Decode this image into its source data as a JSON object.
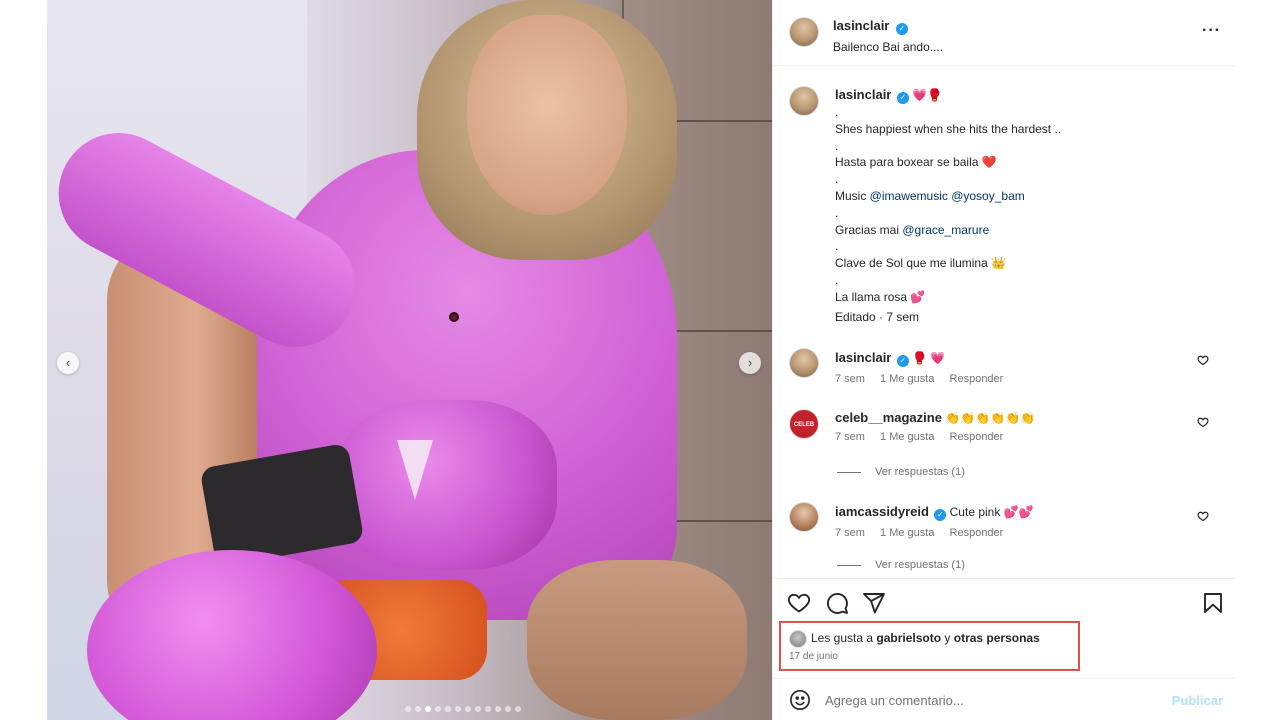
{
  "media": {
    "prev_glyph": "‹",
    "next_glyph": "›",
    "dot_count": 12,
    "active_dot": 2
  },
  "header": {
    "username": "lasinclair",
    "verified_glyph": "✓",
    "subtitle": "Bailenco Bai ando....",
    "more_glyph": "···"
  },
  "caption": {
    "username": "lasinclair",
    "verified_glyph": "✓",
    "emojis": "💗🥊",
    "lines": [
      ".",
      "Shes happiest when she hits the hardest ..",
      ".",
      "Hasta para boxear se baila ❤️",
      ".",
      "Music ",
      ".",
      "Gracias mai ",
      ".",
      "Clave de Sol que me ilumina 👑",
      ".",
      "La llama rosa 💕"
    ],
    "music_links": "@imawemusic @yosoy_bam",
    "thanks_link": "@grace_marure",
    "edited": "Editado · 7 sem"
  },
  "comments": [
    {
      "username": "lasinclair",
      "verified_glyph": "✓",
      "text": "🥊 💗",
      "time": "7 sem",
      "likes": "1 Me gusta",
      "reply": "Responder"
    },
    {
      "username": "celeb__magazine",
      "text": "👏👏👏👏👏👏",
      "time": "7 sem",
      "likes": "1 Me gusta",
      "reply": "Responder",
      "avatar_text": "CELEB MAGAZINE",
      "replies": "Ver respuestas (1)"
    },
    {
      "username": "iamcassidyreid",
      "verified_glyph": "✓",
      "text": "Cute pink 💕💕",
      "time": "7 sem",
      "likes": "1 Me gusta",
      "reply": "Responder",
      "replies": "Ver respuestas (1)"
    }
  ],
  "likes": {
    "prefix": "Les gusta a ",
    "user": "gabrielsoto",
    "middle": " y ",
    "others": "otras personas",
    "date": "17 de junio"
  },
  "add_comment": {
    "placeholder": "Agrega un comentario...",
    "post": "Publicar"
  },
  "colors": {
    "highlight_box": "#d9534f",
    "verified": "#1d9bf0",
    "link": "#00376b",
    "post_disabled": "#b2dffc"
  }
}
